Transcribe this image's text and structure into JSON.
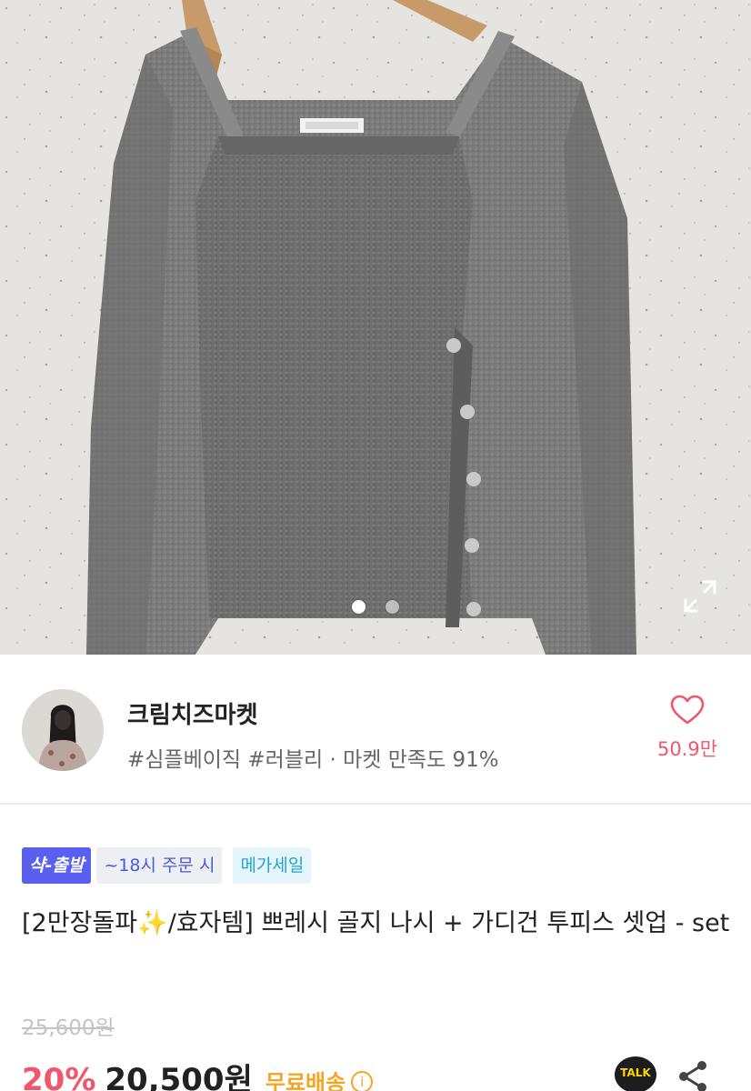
{
  "gallery": {
    "current_slide": 1,
    "slides": 2,
    "expand_icon": "expand-icon"
  },
  "shop": {
    "name": "크림치즈마켓",
    "tags": "#심플베이직 #러블리 · 마켓 만족도 91%",
    "like_count": "50.9만",
    "like_icon": "heart-icon",
    "accent": "#f0566c"
  },
  "product": {
    "badges": [
      "샥-출발",
      "~18시 주문 시",
      "메가세일"
    ],
    "title": "[2만장돌파✨/효자템] 쁘레시 골지 나시 + 가디건 투피스 셋업 - set",
    "original_price": "25,600원",
    "discount": "20%",
    "price": "20,500원",
    "shipping": "무료배송",
    "talk_label": "TALK",
    "share_icon": "share-icon"
  }
}
